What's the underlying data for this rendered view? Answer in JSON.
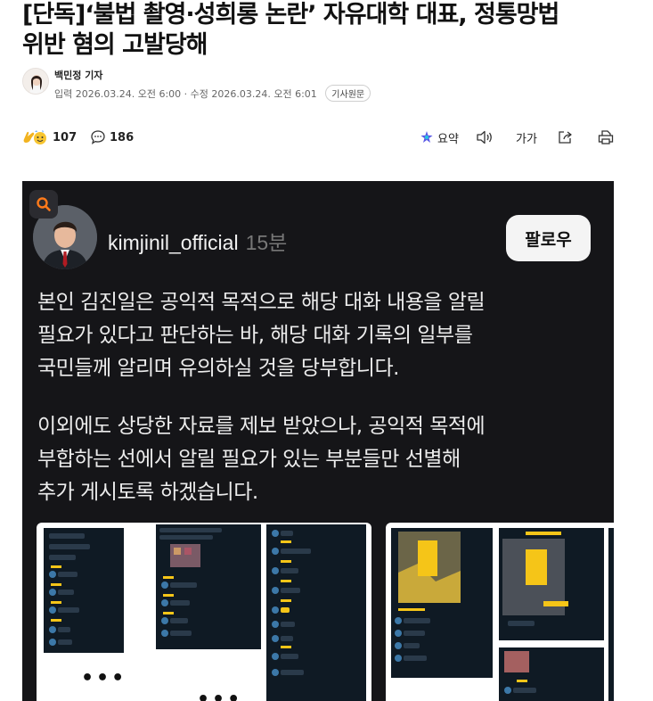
{
  "article": {
    "headline_line1": "[단독]‘불법 촬영·성희롱 논란’ 자유대학 대표, 정통망법",
    "headline_line2": "위반 혐의 고발당해",
    "reporter": "백민정 기자",
    "dates": "입력 2026.03.24. 오전 6:00 · 수정 2026.03.24. 오전 6:01",
    "original_badge": "기사원문"
  },
  "actions": {
    "reaction_count": "107",
    "comment_count": "186",
    "summary_label": "요약",
    "font_label": "가가",
    "icons": [
      "reaction-emoji-icon",
      "comment-icon",
      "summary-icon",
      "speaker-icon",
      "font-size-icon",
      "share-icon",
      "print-icon"
    ]
  },
  "post": {
    "handle": "kimjinil_official",
    "time_ago": "15분",
    "follow_label": "팔로우",
    "para1_lines": [
      "본인 김진일은 공익적 목적으로 해당 대화 내용을 알릴",
      "필요가 있다고 판단하는 바, 해당 대화 기록의 일부를",
      "국민들께 알리며 유의하실 것을 당부합니다."
    ],
    "para2_lines": [
      "이외에도 상당한 자료를 제보 받았으나, 공익적 목적에",
      "부합하는 선에서 알릴 필요가 있는 부분들만 선별해",
      "추가 게시토록 하겠습니다."
    ],
    "more_dots": "•••"
  },
  "colors": {
    "post_bg": "#151518",
    "chat_bg": "#0f1a24",
    "censor_yellow": "#f5c518",
    "text_light": "#ececec"
  }
}
